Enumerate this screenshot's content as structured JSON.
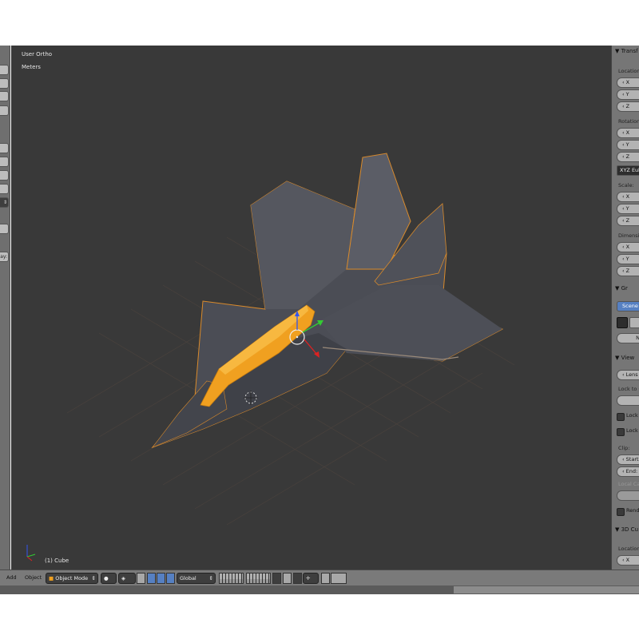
{
  "viewport": {
    "view_name": "User Ortho",
    "units": "Meters",
    "object_label": "(1) Cube"
  },
  "left_toolbar": {
    "partial_label": "ay:"
  },
  "properties_panel": {
    "transform_header": "▼ Transf",
    "location_label": "Location:",
    "rotation_label": "Rotation:",
    "scale_label": "Scale:",
    "dimensions_label": "Dimensio",
    "axis_x": "X",
    "axis_y": "Y",
    "axis_z": "Z",
    "rotation_mode": "XYZ Eule",
    "grease_header": "▼ Gr",
    "scene_button": "Scene",
    "new_button": "N",
    "view_header": "▼ View",
    "lens_field": "Lens",
    "lock_to_label": "Lock to O",
    "lock_1": "Lock",
    "lock_2": "Lock",
    "clip_label": "Clip:",
    "clip_start": "Start",
    "clip_end": "End:",
    "local_camera": "Local Ca",
    "render_check": "Rende",
    "cursor_header": "▼ 3D Cu",
    "cursor_location": "Location",
    "cursor_x": "X"
  },
  "header": {
    "menu_add": "Add",
    "menu_object": "Object",
    "mode": "Object Mode",
    "orientation": "Global"
  },
  "colors": {
    "viewport_bg": "#393939",
    "selection_orange": "#f0a020",
    "outline_orange": "#d98a2b",
    "panel_grey": "#767676",
    "accent_blue": "#5680c2"
  }
}
